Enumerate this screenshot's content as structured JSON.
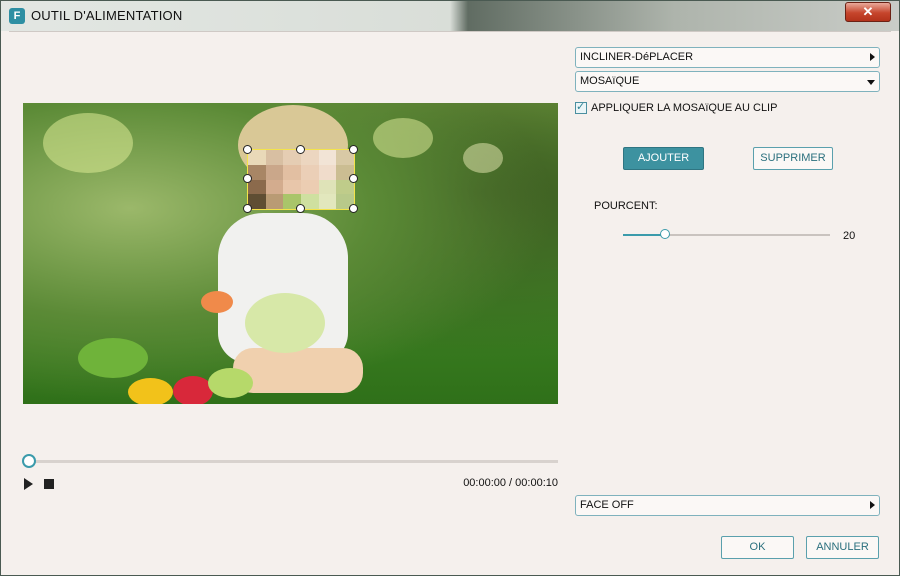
{
  "window": {
    "icon_letter": "F",
    "title": "OUTIL D'ALIMENTATION",
    "close_glyph": "✕"
  },
  "panel": {
    "tilt_shift": "INCLINER-DéPLACER",
    "effect_select": "MOSAïQUE",
    "apply_to_clip": "APPLIQUER LA MOSAïQUE AU CLIP",
    "apply_to_clip_checked": true,
    "add_button": "AJOUTER",
    "delete_button": "SUPPRIMER",
    "percent_label": "POURCENT:",
    "percent_value": "20",
    "percent_fraction": 0.2,
    "face_off": "FACE OFF",
    "ok_button": "OK",
    "cancel_button": "ANNULER"
  },
  "player": {
    "time": "00:00:00 / 00:00:10",
    "progress": 0
  },
  "colors": {
    "accent": "#3d92a0",
    "mosaic_border": "#f3e34a",
    "close_red": "#c6452c"
  },
  "icons": {
    "play": "play-icon",
    "stop": "stop-icon",
    "dropdown_right": "chevron-right-icon",
    "dropdown_down": "chevron-down-icon"
  }
}
